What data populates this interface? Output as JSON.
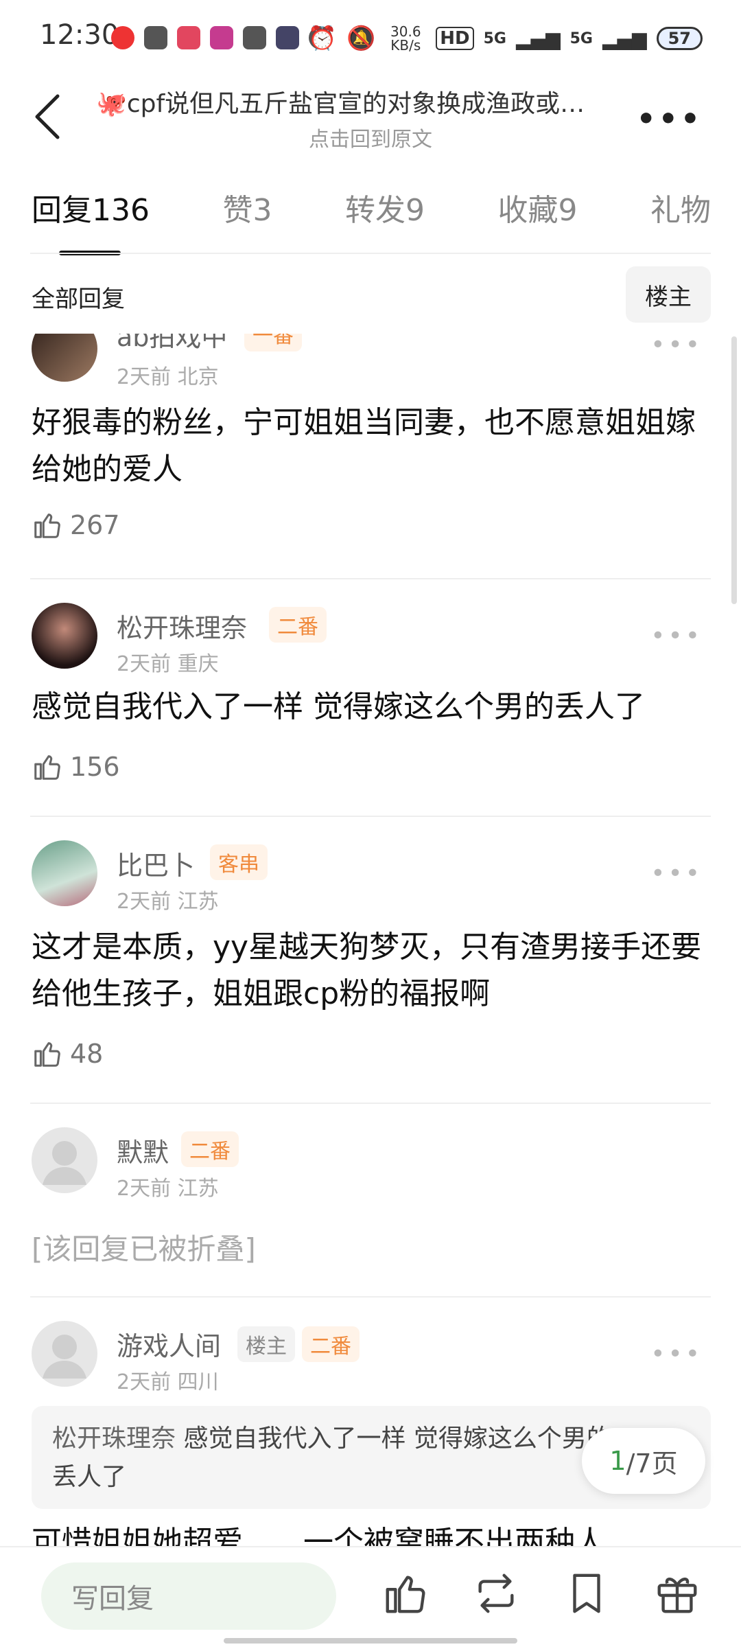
{
  "status": {
    "time": "12:30",
    "net_speed": "30.6 KB/s",
    "signal1": "5G",
    "signal2": "5G",
    "battery": "57"
  },
  "header": {
    "title": "cpf说但凡五斤盐官宣的对象换成渔政或…",
    "subtitle": "点击回到原文",
    "back": "back-icon"
  },
  "tabs": [
    {
      "label": "回复",
      "count": "136"
    },
    {
      "label": "赞",
      "count": "3"
    },
    {
      "label": "转发",
      "count": "9"
    },
    {
      "label": "收藏",
      "count": "9"
    },
    {
      "label": "礼物",
      "count": ""
    }
  ],
  "section": {
    "all_replies": "全部回复",
    "louzhu": "楼主"
  },
  "comments": [
    {
      "name": "ab拍戏中",
      "badge": "一番",
      "meta": "2天前  北京",
      "text": "好狠毒的粉丝，宁可姐姐当同妻，也不愿意姐姐嫁给她的爱人",
      "likes": "267"
    },
    {
      "name": "松开珠理奈",
      "badge": "二番",
      "meta": "2天前  重庆",
      "text": "感觉自我代入了一样 觉得嫁这么个男的丢人了",
      "likes": "156"
    },
    {
      "name": "比巴卜",
      "badge": "客串",
      "meta": "2天前  江苏",
      "text": "这才是本质，yy星越天狗梦灭，只有渣男接手还要给他生孩子，姐姐跟cp粉的福报啊",
      "likes": "48"
    },
    {
      "name": "默默",
      "badge": "二番",
      "meta": "2天前  江苏",
      "text": "[该回复已被折叠]"
    },
    {
      "name": "游戏人间",
      "badge_owner": "楼主",
      "badge": "二番",
      "meta": "2天前  四川",
      "quote_name": "松开珠理奈",
      "quote_text": "感觉自我代入了一样 觉得嫁这么个男的丢人了",
      "text": "可惜姐姐她超爱……一个被窝睡不出两种人"
    }
  ],
  "pager": {
    "current": "1",
    "total": "/7页"
  },
  "bottom": {
    "reply_placeholder": "写回复",
    "icons": [
      "like-icon",
      "repost-icon",
      "bookmark-icon",
      "gift-icon"
    ]
  }
}
